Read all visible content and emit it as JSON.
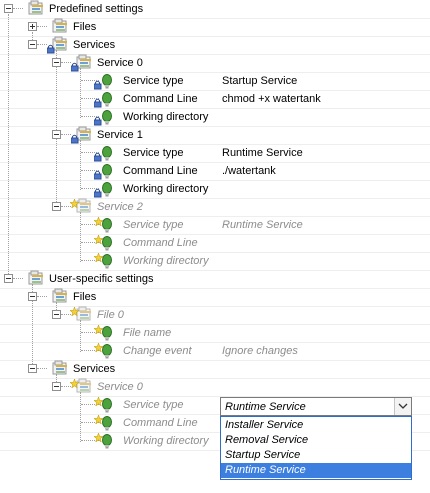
{
  "tree": {
    "predefined_settings": {
      "label": "Predefined settings",
      "files": {
        "label": "Files"
      },
      "services": {
        "label": "Services",
        "service0": {
          "label": "Service 0",
          "service_type": {
            "label": "Service type",
            "value": "Startup Service"
          },
          "command_line": {
            "label": "Command Line",
            "value": "chmod +x watertank"
          },
          "working_directory": {
            "label": "Working directory",
            "value": ""
          }
        },
        "service1": {
          "label": "Service 1",
          "service_type": {
            "label": "Service type",
            "value": "Runtime Service"
          },
          "command_line": {
            "label": "Command Line",
            "value": "./watertank"
          },
          "working_directory": {
            "label": "Working directory",
            "value": ""
          }
        },
        "service2": {
          "label": "Service 2",
          "service_type": {
            "label": "Service type",
            "value": "Runtime Service"
          },
          "command_line": {
            "label": "Command Line",
            "value": ""
          },
          "working_directory": {
            "label": "Working directory",
            "value": ""
          }
        }
      }
    },
    "user_specific_settings": {
      "label": "User-specific settings",
      "files": {
        "label": "Files",
        "file0": {
          "label": "File 0",
          "file_name": {
            "label": "File name",
            "value": ""
          },
          "change_event": {
            "label": "Change event",
            "value": "Ignore changes"
          }
        }
      },
      "services": {
        "label": "Services",
        "service0": {
          "label": "Service 0",
          "service_type": {
            "label": "Service type"
          },
          "command_line": {
            "label": "Command Line"
          },
          "working_directory": {
            "label": "Working directory"
          }
        }
      }
    }
  },
  "dropdown": {
    "selected": "Runtime Service",
    "options": [
      "Installer Service",
      "Removal Service",
      "Startup Service",
      "Runtime Service"
    ]
  },
  "icons": [
    "folder-settings-icon",
    "lightbulb-icon",
    "lock-icon",
    "star-new-icon",
    "chevron-down-icon"
  ],
  "colors": {
    "selection": "#3d7fdf",
    "disabled_text": "#8c8c8c",
    "bulb_green": "#4ca23c"
  }
}
